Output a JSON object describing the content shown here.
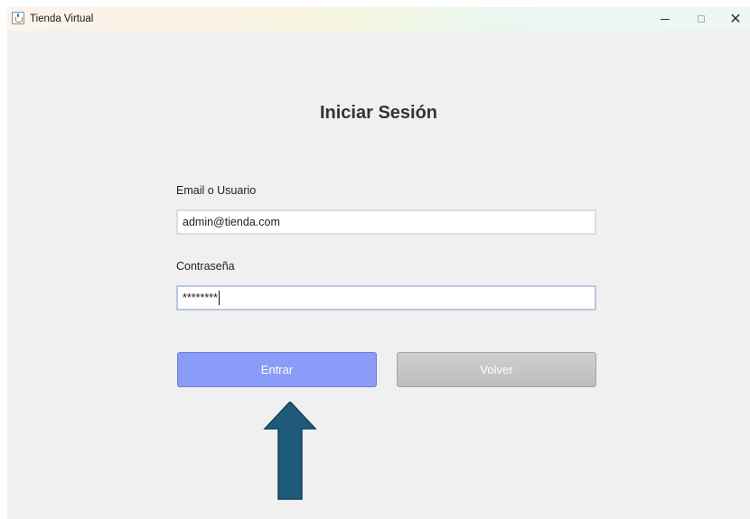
{
  "window": {
    "title": "Tienda Virtual",
    "controls": {
      "minimize": "minimize-icon",
      "maximize": "maximize-icon",
      "close": "close-icon"
    }
  },
  "form": {
    "heading": "Iniciar Sesión",
    "email_label": "Email o Usuario",
    "email_value": "admin@tienda.com",
    "password_label": "Contraseña",
    "password_value": "********",
    "submit_label": "Entrar",
    "back_label": "Volver"
  },
  "colors": {
    "submit_button": "#8b9cf8",
    "back_button": "#c6c6c6",
    "arrow_fill": "#1f5a7a",
    "background": "#f0f0f0"
  }
}
